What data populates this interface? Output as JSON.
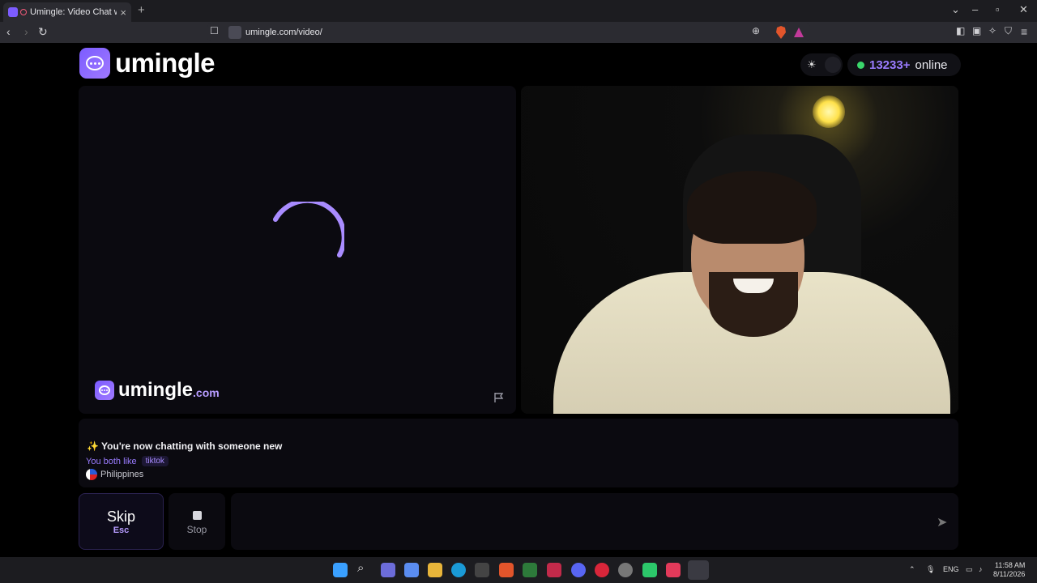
{
  "browser": {
    "tab_title": "Umingle: Video Chat with Str",
    "url": "umingle.com/video/"
  },
  "header": {
    "logo_text": "umingle",
    "online_count": "13233+",
    "online_label": "online"
  },
  "left_video": {
    "watermark_main": "umingle",
    "watermark_suffix": ".com"
  },
  "info": {
    "message": "✨ You're now chatting with someone new",
    "likes_label": "You both like",
    "likes_tag": "tiktok",
    "country": "Philippines"
  },
  "controls": {
    "skip_label": "Skip",
    "skip_key": "Esc",
    "stop_label": "Stop"
  },
  "taskbar": {
    "lang": "ENG",
    "time": "11:58 AM",
    "date": "8/11/2026"
  },
  "colors": {
    "accent": "#9a7cff",
    "online_dot": "#3ad66b"
  }
}
